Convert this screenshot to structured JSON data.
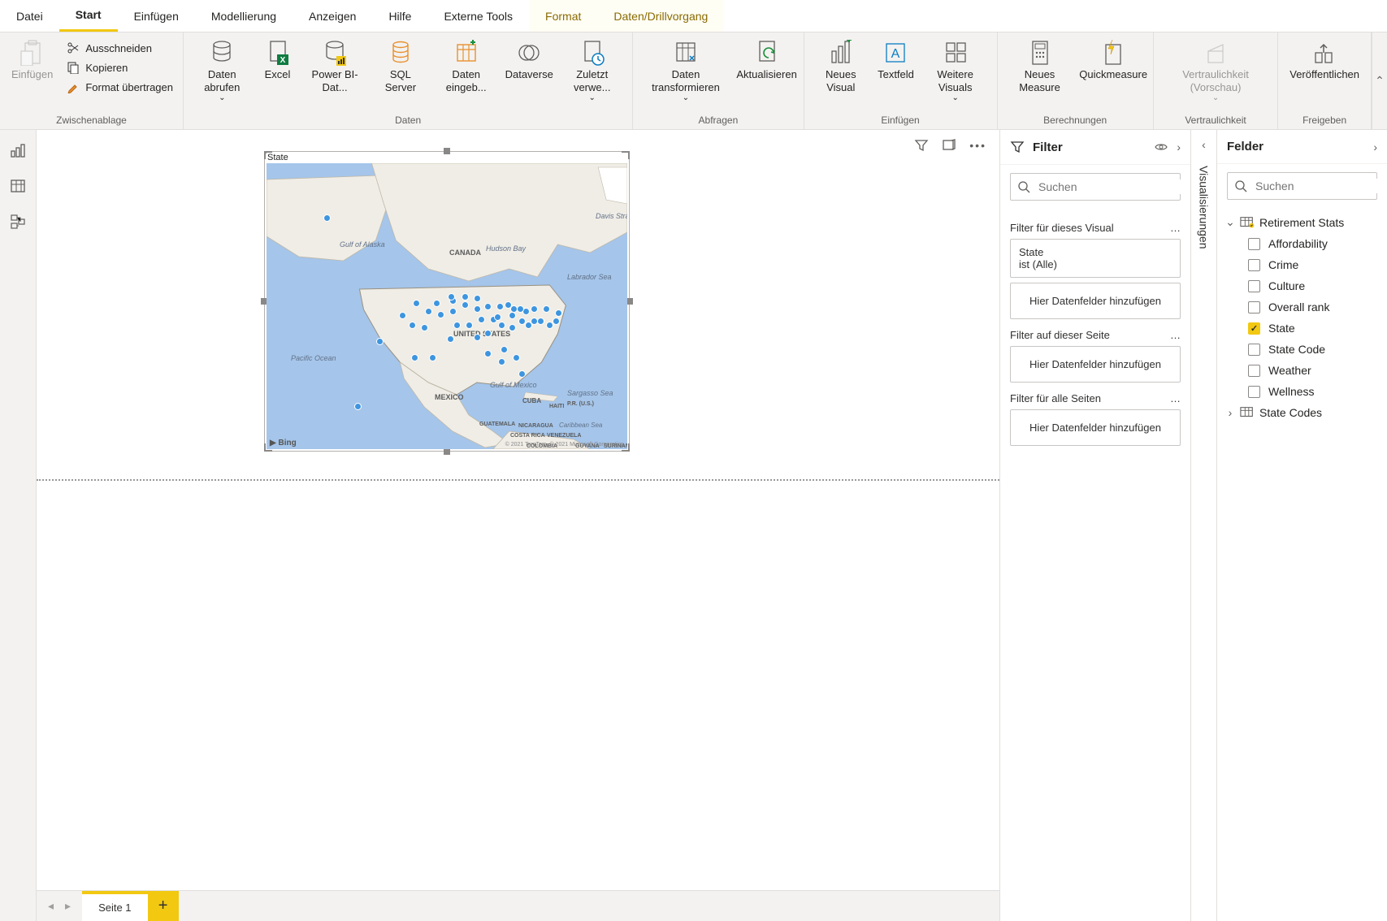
{
  "menubar": {
    "items": [
      "Datei",
      "Start",
      "Einfügen",
      "Modellierung",
      "Anzeigen",
      "Hilfe",
      "Externe Tools"
    ],
    "contextual": [
      "Format",
      "Daten/Drillvorgang"
    ],
    "active": "Start"
  },
  "ribbon": {
    "clipboard": {
      "label": "Zwischenablage",
      "paste": "Einfügen",
      "cut": "Ausschneiden",
      "copy": "Kopieren",
      "format_painter": "Format übertragen"
    },
    "data": {
      "label": "Daten",
      "get_data": "Daten abrufen",
      "excel": "Excel",
      "pbi": "Power BI-Dat...",
      "sql": "SQL Server",
      "enter": "Daten eingeb...",
      "dataverse": "Dataverse",
      "recent": "Zuletzt verwe..."
    },
    "queries": {
      "label": "Abfragen",
      "transform": "Daten transformieren",
      "refresh": "Aktualisieren"
    },
    "insert": {
      "label": "Einfügen",
      "visual": "Neues Visual",
      "textbox": "Textfeld",
      "more": "Weitere Visuals"
    },
    "calc": {
      "label": "Berechnungen",
      "measure": "Neues Measure",
      "quick": "Quickmeasure"
    },
    "sens": {
      "label": "Vertraulichkeit",
      "btn": "Vertraulichkeit (Vorschau)"
    },
    "share": {
      "label": "Freigeben",
      "publish": "Veröffentlichen"
    }
  },
  "visual": {
    "title": "State",
    "bing": "Bing",
    "attrib": "© 2021 TomTom, © 2021 Microsoft Corporation"
  },
  "filters": {
    "title": "Filter",
    "search_ph": "Suchen",
    "section_visual": "Filter für dieses Visual",
    "card_field": "State",
    "card_value": "ist (Alle)",
    "drop": "Hier Datenfelder hinzufügen",
    "section_page": "Filter auf dieser Seite",
    "section_all": "Filter für alle Seiten"
  },
  "viz": {
    "title": "Visualisierungen"
  },
  "fields": {
    "title": "Felder",
    "search_ph": "Suchen",
    "tables": [
      {
        "name": "Retirement Stats",
        "expanded": true,
        "fields": [
          {
            "name": "Affordability",
            "checked": false
          },
          {
            "name": "Crime",
            "checked": false
          },
          {
            "name": "Culture",
            "checked": false
          },
          {
            "name": "Overall rank",
            "checked": false
          },
          {
            "name": "State",
            "checked": true
          },
          {
            "name": "State Code",
            "checked": false
          },
          {
            "name": "Weather",
            "checked": false
          },
          {
            "name": "Wellness",
            "checked": false
          }
        ]
      },
      {
        "name": "State Codes",
        "expanded": false
      }
    ]
  },
  "footer": {
    "page": "Seite 1"
  }
}
